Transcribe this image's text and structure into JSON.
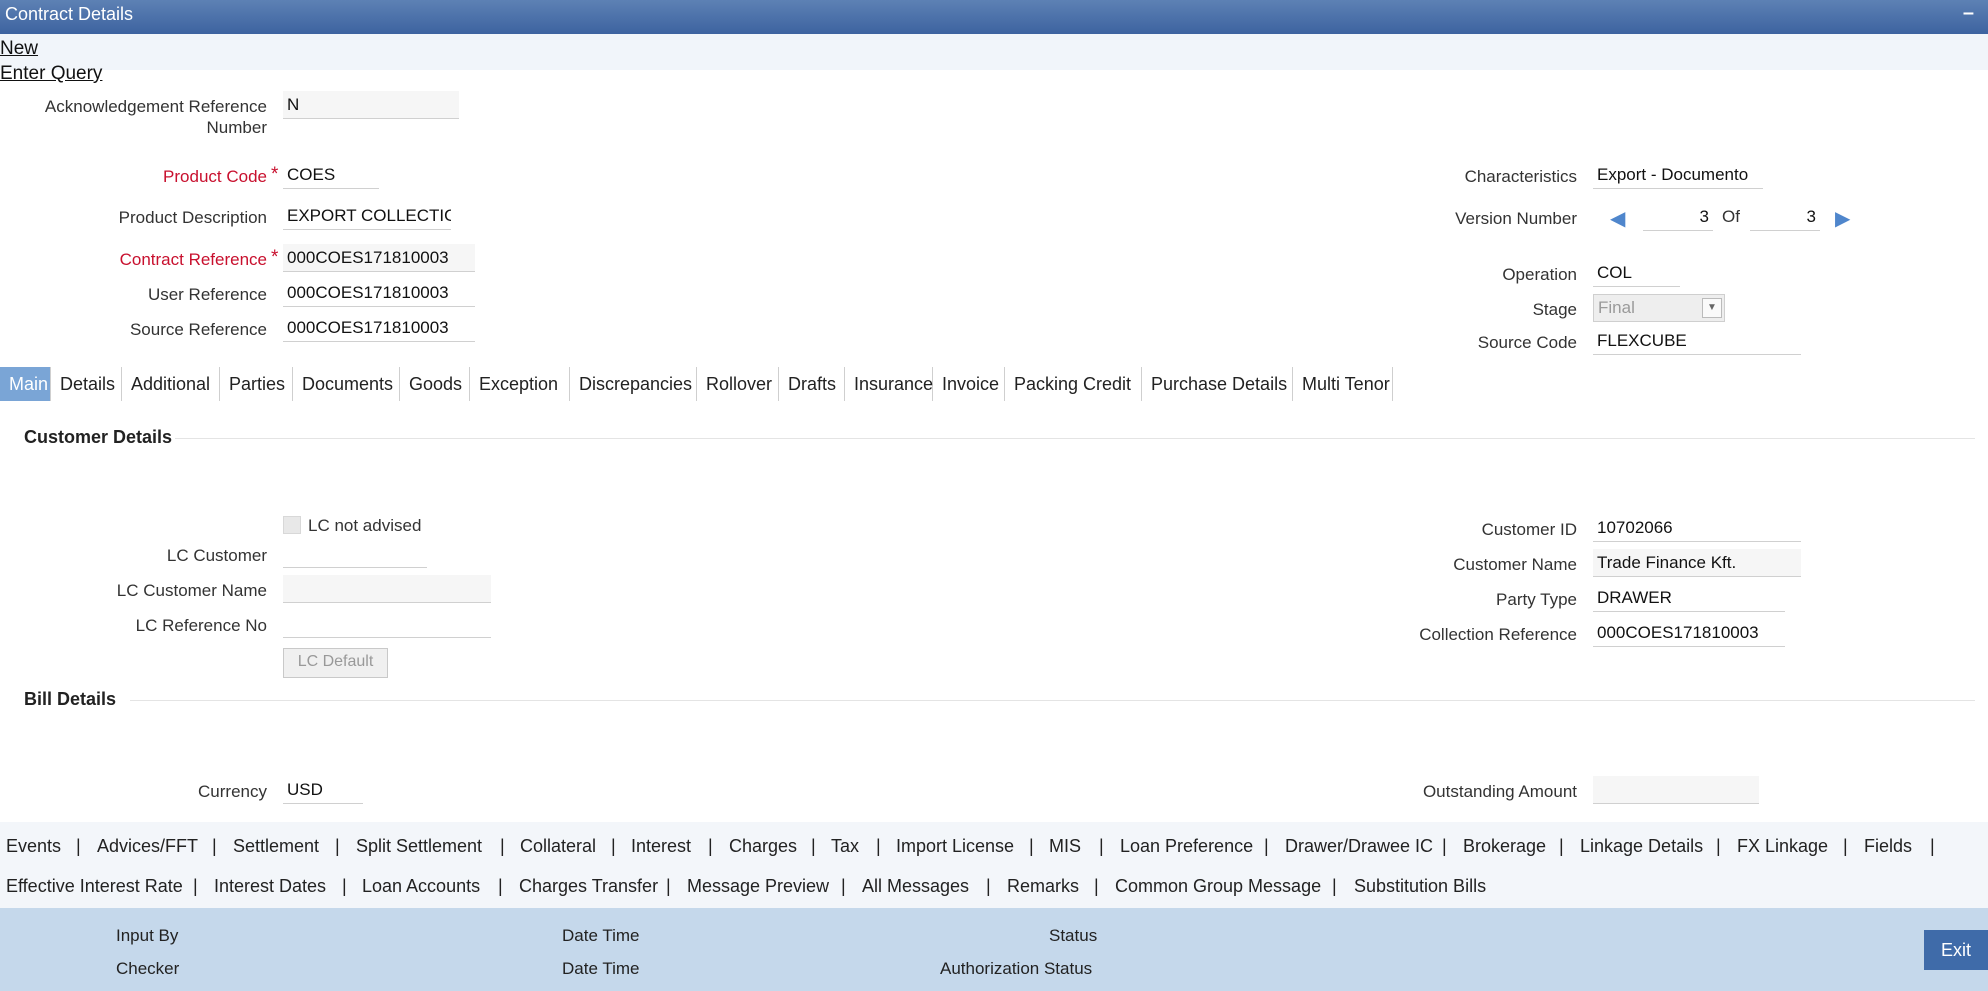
{
  "window": {
    "title": "Contract Details",
    "minimize": "–"
  },
  "toolbar": {
    "new": "New",
    "enter_query": "Enter Query"
  },
  "header": {
    "ack_ref_label_1": "Acknowledgement Reference",
    "ack_ref_label_2": "Number",
    "ack_ref_value": "N",
    "product_code_label": "Product Code",
    "product_code_value": "COES",
    "product_desc_label": "Product Description",
    "product_desc_value": "EXPORT COLLECTIO",
    "contract_ref_label": "Contract Reference",
    "contract_ref_value": "000COES171810003",
    "user_ref_label": "User Reference",
    "user_ref_value": "000COES171810003",
    "source_ref_label": "Source Reference",
    "source_ref_value": "000COES171810003",
    "characteristics_label": "Characteristics",
    "characteristics_value": "Export  - Documento",
    "version_label": "Version Number",
    "version_current": "3",
    "version_of": "Of",
    "version_total": "3",
    "operation_label": "Operation",
    "operation_value": "COL",
    "stage_label": "Stage",
    "stage_value": "Final",
    "source_code_label": "Source Code",
    "source_code_value": "FLEXCUBE",
    "required_mark": "*"
  },
  "tabs": [
    "Main",
    "Details",
    "Additional",
    "Parties",
    "Documents",
    "Goods",
    "Exception",
    "Discrepancies",
    "Rollover",
    "Drafts",
    "Insurance",
    "Invoice",
    "Packing Credit",
    "Purchase Details",
    "Multi Tenor"
  ],
  "customer": {
    "section_title": "Customer Details",
    "lc_not_advised": "LC not advised",
    "lc_customer_label": "LC Customer",
    "lc_customer_name_label": "LC Customer Name",
    "lc_reference_label": "LC Reference No",
    "lc_default_button": "LC Default",
    "customer_id_label": "Customer ID",
    "customer_id_value": "10702066",
    "customer_name_label": "Customer Name",
    "customer_name_value": "Trade Finance Kft.",
    "party_type_label": "Party Type",
    "party_type_value": "DRAWER",
    "collection_ref_label": "Collection Reference",
    "collection_ref_value": "000COES171810003"
  },
  "bill": {
    "section_title": "Bill Details",
    "currency_label": "Currency",
    "currency_value": "USD",
    "outstanding_label": "Outstanding Amount"
  },
  "bottom_row1": [
    "Events",
    "Advices/FFT",
    "Settlement",
    "Split Settlement",
    "Collateral",
    "Interest",
    "Charges",
    "Tax",
    "Import License",
    "MIS",
    "Loan Preference",
    "Drawer/Drawee IC",
    "Brokerage",
    "Linkage Details",
    "FX Linkage",
    "Fields"
  ],
  "bottom_row2": [
    "Effective Interest Rate",
    "Interest Dates",
    "Loan Accounts",
    "Charges Transfer",
    "Message Preview",
    "All Messages",
    "Remarks",
    "Common Group Message",
    "Substitution Bills"
  ],
  "separator": "|",
  "audit": {
    "input_by": "Input By",
    "date_time_1": "Date Time",
    "status": "Status",
    "checker": "Checker",
    "date_time_2": "Date Time",
    "auth_status": "Authorization Status",
    "exit": "Exit"
  }
}
